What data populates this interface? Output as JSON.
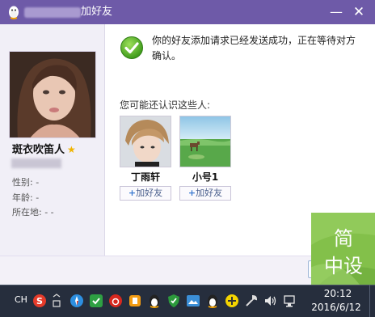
{
  "window": {
    "title": "加好友",
    "minimize_glyph": "—",
    "close_glyph": "✕"
  },
  "profile": {
    "nickname": "斑衣吹笛人",
    "gender_label": "性别: -",
    "age_label": "年龄: -",
    "location_label": "所在地: -   -"
  },
  "message": {
    "success_text": "你的好友添加请求已经发送成功，正在等待对方确认。"
  },
  "suggestions": {
    "title": "您可能还认识这些人:",
    "items": [
      {
        "name": "丁雨轩",
        "add_label": "加好友"
      },
      {
        "name": "小号1",
        "add_label": "加好友"
      }
    ],
    "add_plus": "+"
  },
  "watermark": {
    "line1": "简",
    "line2": "中设"
  },
  "taskbar": {
    "lang": "CH",
    "time": "20:12",
    "date": "2016/6/12",
    "tray_icons": [
      "sogou-ime-icon",
      "tray-arrow-icon",
      "safari-icon",
      "wechat-icon",
      "netease-music-icon",
      "app-icon",
      "qq-icon",
      "security-shield-icon",
      "photo-app-icon",
      "qq-icon-2",
      "add-app-icon",
      "tool-icon",
      "volume-icon",
      "network-icon"
    ]
  },
  "colors": {
    "titlebar": "#6e5aa8",
    "taskbar": "#262e3d",
    "watermark": "#83c04a"
  }
}
